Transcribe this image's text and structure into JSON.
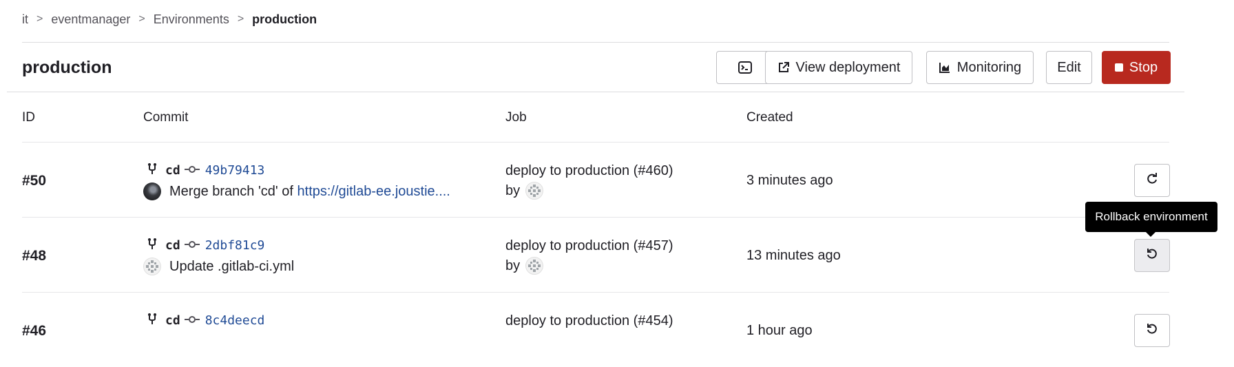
{
  "breadcrumb": {
    "items": [
      "it",
      "eventmanager",
      "Environments"
    ],
    "current": "production",
    "separator": ">"
  },
  "page": {
    "title": "production"
  },
  "toolbar": {
    "view_deployment": "View deployment",
    "monitoring": "Monitoring",
    "edit": "Edit",
    "stop": "Stop"
  },
  "table": {
    "headers": {
      "id": "ID",
      "commit": "Commit",
      "job": "Job",
      "created": "Created"
    },
    "rows": [
      {
        "id": "#50",
        "ref": "cd",
        "sha": "49b79413",
        "message_prefix": "Merge branch 'cd' of",
        "message_link": "https://gitlab-ee.joustie....",
        "job": "deploy to production (#460)",
        "by": "by",
        "created": "3 minutes ago",
        "action_icon": "retry-icon"
      },
      {
        "id": "#48",
        "ref": "cd",
        "sha": "2dbf81c9",
        "message_prefix": "Update .gitlab-ci.yml",
        "message_link": "",
        "job": "deploy to production (#457)",
        "by": "by",
        "created": "13 minutes ago",
        "action_icon": "rollback-icon"
      },
      {
        "id": "#46",
        "ref": "cd",
        "sha": "8c4deecd",
        "message_prefix": "",
        "message_link": "",
        "job": "deploy to production (#454)",
        "by": "",
        "created": "1 hour ago",
        "action_icon": "rollback-icon"
      }
    ]
  },
  "tooltip": {
    "text": "Rollback environment"
  },
  "colors": {
    "stop_button": "#b8291f",
    "link": "#1f4a95",
    "tooltip_bg": "#000000"
  }
}
